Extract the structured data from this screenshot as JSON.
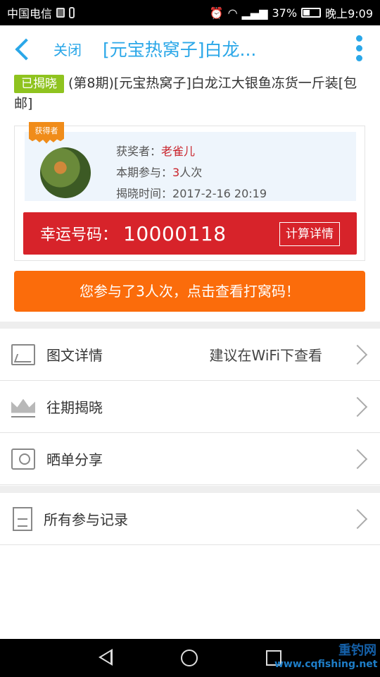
{
  "status_bar": {
    "carrier": "中国电信",
    "signal_text": "37%",
    "time": "晚上9:09"
  },
  "header": {
    "close_label": "关闭",
    "title": "[元宝热窝子]白龙..."
  },
  "product": {
    "badge": "已揭晓",
    "title": "(第8期)[元宝热窝子]白龙江大银鱼冻货一斤装[包邮]"
  },
  "winner": {
    "ribbon": "获得者",
    "name_label": "获奖者：",
    "name": "老雀儿",
    "join_label": "本期参与：",
    "join_count": "3",
    "join_unit": "人次",
    "time_label": "揭晓时间：",
    "time": "2017-2-16 20:19"
  },
  "lucky": {
    "label": "幸运号码：",
    "number": "10000118",
    "calc_button": "计算详情"
  },
  "my_codes_button": "您参与了3人次，点击查看打窝码！",
  "menu": {
    "detail_label": "图文详情",
    "detail_hint": "建议在WiFi下查看",
    "history_label": "往期揭晓",
    "share_label": "晒单分享",
    "records_label": "所有参与记录"
  },
  "watermark": {
    "brand": "重钓网",
    "url": "www.cqfishing.net"
  },
  "colors": {
    "accent_blue": "#2aa7e8",
    "lucky_red": "#d7232a",
    "orange": "#fb6c0b",
    "badge_green": "#8fc31f"
  }
}
